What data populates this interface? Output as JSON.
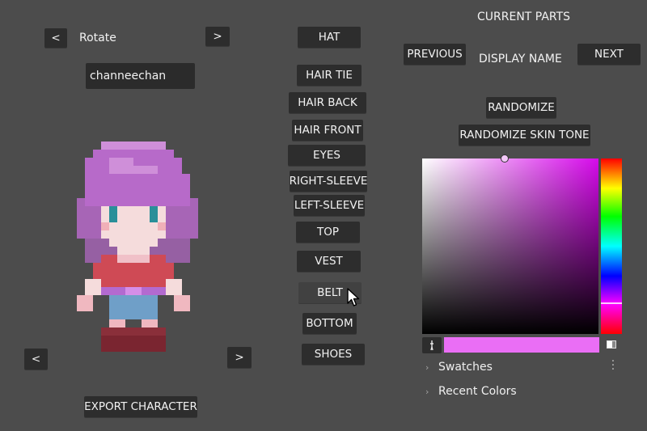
{
  "rotate": {
    "prev": "<",
    "label": "Rotate",
    "next": ">"
  },
  "name_input": {
    "value": "channeechan"
  },
  "bottom_nav": {
    "prev": "<",
    "next": ">"
  },
  "export_label": "EXPORT CHARACTER",
  "parts": [
    "HAT",
    "HAIR TIE",
    "HAIR BACK",
    "HAIR FRONT",
    "EYES",
    "RIGHT-SLEEVE",
    "LEFT-SLEEVE",
    "TOP",
    "VEST",
    "BELT",
    "BOTTOM",
    "SHOES"
  ],
  "right": {
    "current_parts": "CURRENT PARTS",
    "previous": "PREVIOUS",
    "display_name": "DISPLAY NAME",
    "next": "NEXT",
    "randomize": "RANDOMIZE",
    "randomize_skin": "RANDOMIZE SKIN TONE"
  },
  "color_picker": {
    "current_color": "#ea6ef5",
    "hue_color": "#d60aea",
    "swatches_label": "Swatches",
    "recent_label": "Recent Colors"
  },
  "colors": {
    "bg": "#4c4c4c",
    "button": "#2d2d2d",
    "hair": "#b76ac9",
    "hair_light": "#cf8fd9",
    "skin": "#f5dcdc",
    "eye": "#2a8f99",
    "shirt": "#cf4a55",
    "pants": "#6f9fc8",
    "shoes": "#8a2f3a"
  }
}
